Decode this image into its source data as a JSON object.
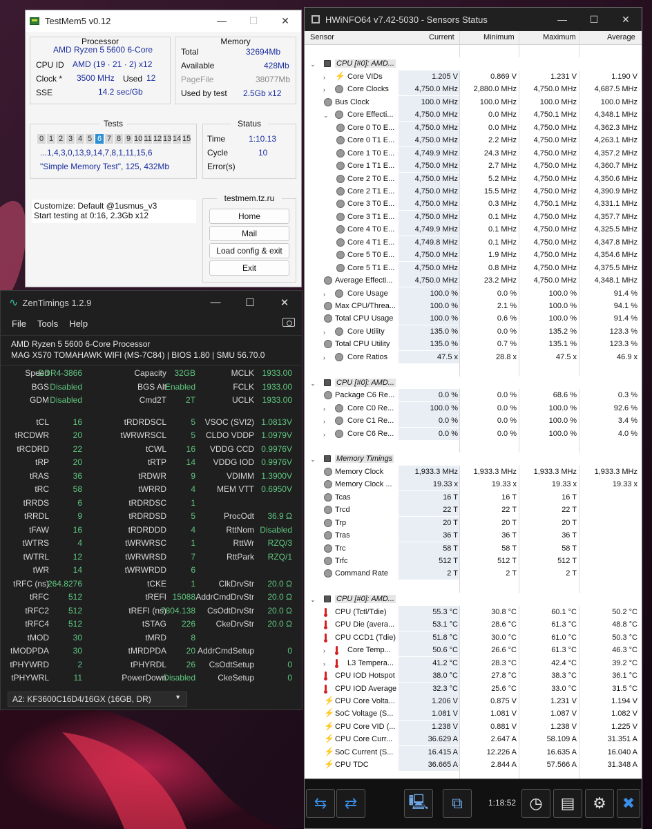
{
  "testmem": {
    "title": "TestMem5 v0.12",
    "processor": {
      "caption": "Processor",
      "name": "AMD Ryzen 5 5600 6-Core",
      "cpuid_label": "CPU ID",
      "cpuid_value": "AMD  (19 · 21 · 2)  x12",
      "clock_label": "Clock *",
      "clock_value": "3500 MHz",
      "used_label": "Used",
      "used_value": "12",
      "sse_label": "SSE",
      "sse_value": "14.2 sec/Gb"
    },
    "memory": {
      "caption": "Memory",
      "total_label": "Total",
      "total_value": "32694Mb",
      "available_label": "Available",
      "available_value": "428Mb",
      "pagefile_label": "PageFile",
      "pagefile_value": "38077Mb",
      "usedbytest_label": "Used by test",
      "usedbytest_value": "2.5Gb x12"
    },
    "tests": {
      "caption": "Tests",
      "numbers": [
        "0",
        "1",
        "2",
        "3",
        "4",
        "5",
        "6",
        "7",
        "8",
        "9",
        "10",
        "11",
        "12",
        "13",
        "14",
        "15"
      ],
      "active": "6",
      "sequence": "...1,4,3,0,13,9,14,7,8,1,11,15,6",
      "current": "\"Simple Memory Test\", 125, 432Mb"
    },
    "status": {
      "caption": "Status",
      "time_label": "Time",
      "time_value": "1:10.13",
      "cycle_label": "Cycle",
      "cycle_value": "10",
      "errors_label": "Error(s)",
      "errors_value": ""
    },
    "log": [
      "Customize: Default @1usmus_v3",
      "Start testing at 0:16, 2.3Gb x12"
    ],
    "site": "testmem.tz.ru",
    "buttons": {
      "home": "Home",
      "mail": "Mail",
      "load": "Load config & exit",
      "exit": "Exit"
    }
  },
  "zen": {
    "title": "ZenTimings 1.2.9",
    "menu": [
      "File",
      "Tools",
      "Help"
    ],
    "cpu": "AMD Ryzen 5 5600 6-Core Processor",
    "board": "MAG X570 TOMAHAWK WIFI (MS-7C84) | BIOS 1.80 | SMU 56.70.0",
    "rows": [
      [
        [
          "Speed",
          "DDR4-3866"
        ],
        [
          "Capacity",
          "32GB"
        ],
        [
          "MCLK",
          "1933.00"
        ]
      ],
      [
        [
          "BGS",
          "Disabled"
        ],
        [
          "BGS Alt",
          "Enabled"
        ],
        [
          "FCLK",
          "1933.00"
        ]
      ],
      [
        [
          "GDM",
          "Disabled"
        ],
        [
          "Cmd2T",
          "2T"
        ],
        [
          "UCLK",
          "1933.00"
        ]
      ],
      null,
      [
        [
          "tCL",
          "16"
        ],
        [
          "tRDRDSCL",
          "5"
        ],
        [
          "VSOC (SVI2)",
          "1.0813V"
        ]
      ],
      [
        [
          "tRCDWR",
          "20"
        ],
        [
          "tWRWRSCL",
          "5"
        ],
        [
          "CLDO VDDP",
          "1.0979V"
        ]
      ],
      [
        [
          "tRCDRD",
          "22"
        ],
        [
          "tCWL",
          "16"
        ],
        [
          "VDDG CCD",
          "0.9976V"
        ]
      ],
      [
        [
          "tRP",
          "20"
        ],
        [
          "tRTP",
          "14"
        ],
        [
          "VDDG IOD",
          "0.9976V"
        ]
      ],
      [
        [
          "tRAS",
          "36"
        ],
        [
          "tRDWR",
          "9"
        ],
        [
          "VDIMM",
          "1.3900V"
        ]
      ],
      [
        [
          "tRC",
          "58"
        ],
        [
          "tWRRD",
          "4"
        ],
        [
          "MEM VTT",
          "0.6950V"
        ]
      ],
      [
        [
          "tRRDS",
          "6"
        ],
        [
          "tRDRDSC",
          "1"
        ],
        [
          "",
          ""
        ]
      ],
      [
        [
          "tRRDL",
          "9"
        ],
        [
          "tRDRDSD",
          "5"
        ],
        [
          "ProcOdt",
          "36.9 Ω"
        ]
      ],
      [
        [
          "tFAW",
          "16"
        ],
        [
          "tRDRDDD",
          "4"
        ],
        [
          "RttNom",
          "Disabled"
        ]
      ],
      [
        [
          "tWTRS",
          "4"
        ],
        [
          "tWRWRSC",
          "1"
        ],
        [
          "RttWr",
          "RZQ/3"
        ]
      ],
      [
        [
          "tWTRL",
          "12"
        ],
        [
          "tWRWRSD",
          "7"
        ],
        [
          "RttPark",
          "RZQ/1"
        ]
      ],
      [
        [
          "tWR",
          "14"
        ],
        [
          "tWRWRDD",
          "6"
        ],
        [
          "",
          ""
        ]
      ],
      [
        [
          "tRFC (ns)",
          "264.8276"
        ],
        [
          "tCKE",
          "1"
        ],
        [
          "ClkDrvStr",
          "20.0 Ω"
        ]
      ],
      [
        [
          "tRFC",
          "512"
        ],
        [
          "tREFI",
          "15088"
        ],
        [
          "AddrCmdDrvStr",
          "20.0 Ω"
        ]
      ],
      [
        [
          "tRFC2",
          "512"
        ],
        [
          "tREFI (ns)",
          "7804.138"
        ],
        [
          "CsOdtDrvStr",
          "20.0 Ω"
        ]
      ],
      [
        [
          "tRFC4",
          "512"
        ],
        [
          "tSTAG",
          "226"
        ],
        [
          "CkeDrvStr",
          "20.0 Ω"
        ]
      ],
      [
        [
          "tMOD",
          "30"
        ],
        [
          "tMRD",
          "8"
        ],
        [
          "",
          ""
        ]
      ],
      [
        [
          "tMODPDA",
          "30"
        ],
        [
          "tMRDPDA",
          "20"
        ],
        [
          "AddrCmdSetup",
          "0"
        ]
      ],
      [
        [
          "tPHYWRD",
          "2"
        ],
        [
          "tPHYRDL",
          "26"
        ],
        [
          "CsOdtSetup",
          "0"
        ]
      ],
      [
        [
          "tPHYWRL",
          "11"
        ],
        [
          "PowerDown",
          "Disabled"
        ],
        [
          "CkeSetup",
          "0"
        ]
      ]
    ],
    "dimm": "A2: KF3600C16D4/16GX (16GB, DR)"
  },
  "hwinfo": {
    "title": "HWiNFO64 v7.42-5030 - Sensors Status",
    "columns": [
      "Sensor",
      "Current",
      "Minimum",
      "Maximum",
      "Average"
    ],
    "time": "1:18:52",
    "rows": [
      {
        "t": "blank"
      },
      {
        "t": "sec",
        "n": "CPU [#0]: AMD..."
      },
      {
        "t": "r",
        "i": "bolt",
        "e": 1,
        "d": 1,
        "n": "Core VIDs",
        "v": [
          "1.205 V",
          "0.869 V",
          "1.231 V",
          "1.190 V"
        ]
      },
      {
        "t": "r",
        "i": "c",
        "e": 1,
        "d": 1,
        "n": "Core Clocks",
        "v": [
          "4,750.0 MHz",
          "2,880.0 MHz",
          "4,750.0 MHz",
          "4,687.5 MHz"
        ]
      },
      {
        "t": "r",
        "i": "c",
        "d": 0,
        "n": "Bus Clock",
        "v": [
          "100.0 MHz",
          "100.0 MHz",
          "100.0 MHz",
          "100.0 MHz"
        ]
      },
      {
        "t": "r",
        "i": "c",
        "e": 2,
        "d": 1,
        "n": "Core Effecti...",
        "v": [
          "4,750.0 MHz",
          "0.0 MHz",
          "4,750.1 MHz",
          "4,348.1 MHz"
        ]
      },
      {
        "t": "r",
        "i": "c",
        "d": 2,
        "n": "Core 0 T0 E...",
        "v": [
          "4,750.0 MHz",
          "0.0 MHz",
          "4,750.0 MHz",
          "4,362.3 MHz"
        ]
      },
      {
        "t": "r",
        "i": "c",
        "d": 2,
        "n": "Core 0 T1 E...",
        "v": [
          "4,750.0 MHz",
          "2.2 MHz",
          "4,750.0 MHz",
          "4,263.1 MHz"
        ]
      },
      {
        "t": "r",
        "i": "c",
        "d": 2,
        "n": "Core 1 T0 E...",
        "v": [
          "4,749.9 MHz",
          "24.3 MHz",
          "4,750.0 MHz",
          "4,357.2 MHz"
        ]
      },
      {
        "t": "r",
        "i": "c",
        "d": 2,
        "n": "Core 1 T1 E...",
        "v": [
          "4,750.0 MHz",
          "2.7 MHz",
          "4,750.0 MHz",
          "4,360.7 MHz"
        ]
      },
      {
        "t": "r",
        "i": "c",
        "d": 2,
        "n": "Core 2 T0 E...",
        "v": [
          "4,750.0 MHz",
          "5.2 MHz",
          "4,750.0 MHz",
          "4,350.6 MHz"
        ]
      },
      {
        "t": "r",
        "i": "c",
        "d": 2,
        "n": "Core 2 T1 E...",
        "v": [
          "4,750.0 MHz",
          "15.5 MHz",
          "4,750.0 MHz",
          "4,390.9 MHz"
        ]
      },
      {
        "t": "r",
        "i": "c",
        "d": 2,
        "n": "Core 3 T0 E...",
        "v": [
          "4,750.0 MHz",
          "0.3 MHz",
          "4,750.1 MHz",
          "4,331.1 MHz"
        ]
      },
      {
        "t": "r",
        "i": "c",
        "d": 2,
        "n": "Core 3 T1 E...",
        "v": [
          "4,750.0 MHz",
          "0.1 MHz",
          "4,750.0 MHz",
          "4,357.7 MHz"
        ]
      },
      {
        "t": "r",
        "i": "c",
        "d": 2,
        "n": "Core 4 T0 E...",
        "v": [
          "4,749.9 MHz",
          "0.1 MHz",
          "4,750.0 MHz",
          "4,325.5 MHz"
        ]
      },
      {
        "t": "r",
        "i": "c",
        "d": 2,
        "n": "Core 4 T1 E...",
        "v": [
          "4,749.8 MHz",
          "0.1 MHz",
          "4,750.0 MHz",
          "4,347.8 MHz"
        ]
      },
      {
        "t": "r",
        "i": "c",
        "d": 2,
        "n": "Core 5 T0 E...",
        "v": [
          "4,750.0 MHz",
          "1.9 MHz",
          "4,750.0 MHz",
          "4,354.6 MHz"
        ]
      },
      {
        "t": "r",
        "i": "c",
        "d": 2,
        "n": "Core 5 T1 E...",
        "v": [
          "4,750.0 MHz",
          "0.8 MHz",
          "4,750.0 MHz",
          "4,375.5 MHz"
        ]
      },
      {
        "t": "r",
        "i": "c",
        "d": 0,
        "n": "Average Effecti...",
        "v": [
          "4,750.0 MHz",
          "23.2 MHz",
          "4,750.0 MHz",
          "4,348.1 MHz"
        ]
      },
      {
        "t": "r",
        "i": "c",
        "e": 1,
        "d": 1,
        "n": "Core Usage",
        "v": [
          "100.0 %",
          "0.0 %",
          "100.0 %",
          "91.4 %"
        ]
      },
      {
        "t": "r",
        "i": "c",
        "d": 0,
        "n": "Max CPU/Threa...",
        "v": [
          "100.0 %",
          "2.1 %",
          "100.0 %",
          "94.1 %"
        ]
      },
      {
        "t": "r",
        "i": "c",
        "d": 0,
        "n": "Total CPU Usage",
        "v": [
          "100.0 %",
          "0.6 %",
          "100.0 %",
          "91.4 %"
        ]
      },
      {
        "t": "r",
        "i": "c",
        "e": 1,
        "d": 1,
        "n": "Core Utility",
        "v": [
          "135.0 %",
          "0.0 %",
          "135.2 %",
          "123.3 %"
        ]
      },
      {
        "t": "r",
        "i": "c",
        "d": 0,
        "n": "Total CPU Utility",
        "v": [
          "135.0 %",
          "0.7 %",
          "135.1 %",
          "123.3 %"
        ]
      },
      {
        "t": "r",
        "i": "c",
        "e": 1,
        "d": 1,
        "n": "Core Ratios",
        "v": [
          "47.5 x",
          "28.8 x",
          "47.5 x",
          "46.9 x"
        ]
      },
      {
        "t": "blank"
      },
      {
        "t": "sec",
        "n": "CPU [#0]: AMD..."
      },
      {
        "t": "r",
        "i": "c",
        "d": 0,
        "n": "Package C6 Re...",
        "v": [
          "0.0 %",
          "0.0 %",
          "68.6 %",
          "0.3 %"
        ]
      },
      {
        "t": "r",
        "i": "c",
        "e": 1,
        "d": 1,
        "n": "Core C0 Re...",
        "v": [
          "100.0 %",
          "0.0 %",
          "100.0 %",
          "92.6 %"
        ]
      },
      {
        "t": "r",
        "i": "c",
        "e": 1,
        "d": 1,
        "n": "Core C1 Re...",
        "v": [
          "0.0 %",
          "0.0 %",
          "100.0 %",
          "3.4 %"
        ]
      },
      {
        "t": "r",
        "i": "c",
        "e": 1,
        "d": 1,
        "n": "Core C6 Re...",
        "v": [
          "0.0 %",
          "0.0 %",
          "100.0 %",
          "4.0 %"
        ]
      },
      {
        "t": "blank"
      },
      {
        "t": "sec",
        "n": "Memory Timings"
      },
      {
        "t": "r",
        "i": "c",
        "d": 0,
        "n": "Memory Clock",
        "v": [
          "1,933.3 MHz",
          "1,933.3 MHz",
          "1,933.3 MHz",
          "1,933.3 MHz"
        ]
      },
      {
        "t": "r",
        "i": "c",
        "d": 0,
        "n": "Memory Clock ...",
        "v": [
          "19.33 x",
          "19.33 x",
          "19.33 x",
          "19.33 x"
        ]
      },
      {
        "t": "r",
        "i": "c",
        "d": 0,
        "n": "Tcas",
        "v": [
          "16 T",
          "16 T",
          "16 T",
          ""
        ]
      },
      {
        "t": "r",
        "i": "c",
        "d": 0,
        "n": "Trcd",
        "v": [
          "22 T",
          "22 T",
          "22 T",
          ""
        ]
      },
      {
        "t": "r",
        "i": "c",
        "d": 0,
        "n": "Trp",
        "v": [
          "20 T",
          "20 T",
          "20 T",
          ""
        ]
      },
      {
        "t": "r",
        "i": "c",
        "d": 0,
        "n": "Tras",
        "v": [
          "36 T",
          "36 T",
          "36 T",
          ""
        ]
      },
      {
        "t": "r",
        "i": "c",
        "d": 0,
        "n": "Trc",
        "v": [
          "58 T",
          "58 T",
          "58 T",
          ""
        ]
      },
      {
        "t": "r",
        "i": "c",
        "d": 0,
        "n": "Trfc",
        "v": [
          "512 T",
          "512 T",
          "512 T",
          ""
        ]
      },
      {
        "t": "r",
        "i": "c",
        "d": 0,
        "n": "Command Rate",
        "v": [
          "2 T",
          "2 T",
          "2 T",
          ""
        ]
      },
      {
        "t": "blank"
      },
      {
        "t": "sec",
        "n": "CPU [#0]: AMD..."
      },
      {
        "t": "r",
        "i": "therm",
        "d": 0,
        "n": "CPU (Tctl/Tdie)",
        "v": [
          "55.3 °C",
          "30.8 °C",
          "60.1 °C",
          "50.2 °C"
        ]
      },
      {
        "t": "r",
        "i": "therm",
        "d": 0,
        "n": "CPU Die (avera...",
        "v": [
          "53.1 °C",
          "28.6 °C",
          "61.3 °C",
          "48.8 °C"
        ]
      },
      {
        "t": "r",
        "i": "therm",
        "d": 0,
        "n": "CPU CCD1 (Tdie)",
        "v": [
          "51.8 °C",
          "30.0 °C",
          "61.0 °C",
          "50.3 °C"
        ]
      },
      {
        "t": "r",
        "i": "therm",
        "e": 1,
        "d": 1,
        "n": "Core Temp...",
        "v": [
          "50.6 °C",
          "26.6 °C",
          "61.3 °C",
          "46.3 °C"
        ]
      },
      {
        "t": "r",
        "i": "therm",
        "e": 1,
        "d": 1,
        "n": "L3 Tempera...",
        "v": [
          "41.2 °C",
          "28.3 °C",
          "42.4 °C",
          "39.2 °C"
        ]
      },
      {
        "t": "r",
        "i": "therm",
        "d": 0,
        "n": "CPU IOD Hotspot",
        "v": [
          "38.0 °C",
          "27.8 °C",
          "38.3 °C",
          "36.1 °C"
        ]
      },
      {
        "t": "r",
        "i": "therm",
        "d": 0,
        "n": "CPU IOD Average",
        "v": [
          "32.3 °C",
          "25.6 °C",
          "33.0 °C",
          "31.5 °C"
        ]
      },
      {
        "t": "r",
        "i": "bolt",
        "d": 0,
        "n": "CPU Core Volta...",
        "v": [
          "1.206 V",
          "0.875 V",
          "1.231 V",
          "1.194 V"
        ]
      },
      {
        "t": "r",
        "i": "bolt",
        "d": 0,
        "n": "SoC Voltage (S...",
        "v": [
          "1.081 V",
          "1.081 V",
          "1.087 V",
          "1.082 V"
        ]
      },
      {
        "t": "r",
        "i": "bolt",
        "d": 0,
        "n": "CPU Core VID (...",
        "v": [
          "1.238 V",
          "0.881 V",
          "1.238 V",
          "1.225 V"
        ]
      },
      {
        "t": "r",
        "i": "bolt",
        "d": 0,
        "n": "CPU Core Curr...",
        "v": [
          "36.629 A",
          "2.647 A",
          "58.109 A",
          "31.351 A"
        ]
      },
      {
        "t": "r",
        "i": "bolt",
        "d": 0,
        "n": "SoC Current (S...",
        "v": [
          "16.415 A",
          "12.226 A",
          "16.635 A",
          "16.040 A"
        ]
      },
      {
        "t": "r",
        "i": "bolt",
        "d": 0,
        "n": "CPU TDC",
        "v": [
          "36.665 A",
          "2.844 A",
          "57.566 A",
          "31.348 A"
        ]
      }
    ]
  }
}
